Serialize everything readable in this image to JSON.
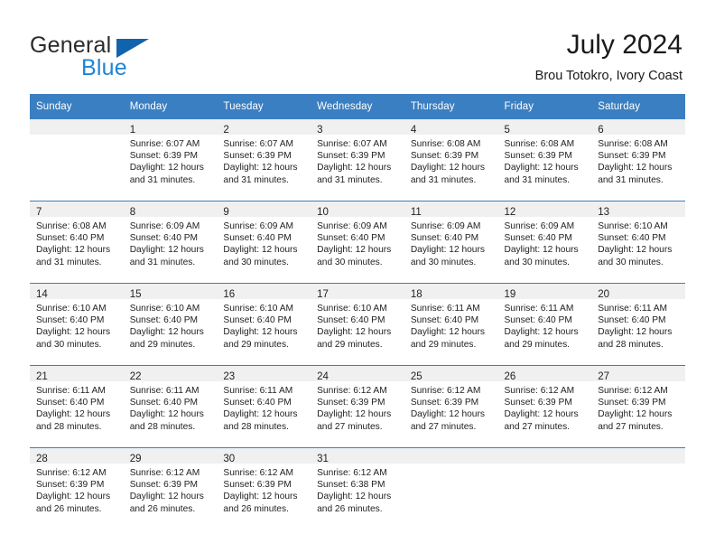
{
  "brand": {
    "name_part1": "General",
    "name_part2": "Blue",
    "color_primary": "#1f85d4",
    "color_triangle": "#1263ad"
  },
  "header": {
    "title": "July 2024",
    "subtitle": "Brou Totokro, Ivory Coast"
  },
  "theme": {
    "header_row_bg": "#3a7fc1",
    "daynum_band_bg": "#f0f0f0",
    "separator": "#3a7fc1"
  },
  "weekday_headers": [
    "Sunday",
    "Monday",
    "Tuesday",
    "Wednesday",
    "Thursday",
    "Friday",
    "Saturday"
  ],
  "weeks": [
    [
      {
        "day": "",
        "sunrise": "",
        "sunset": "",
        "daylight1": "",
        "daylight2": ""
      },
      {
        "day": "1",
        "sunrise": "Sunrise: 6:07 AM",
        "sunset": "Sunset: 6:39 PM",
        "daylight1": "Daylight: 12 hours",
        "daylight2": "and 31 minutes."
      },
      {
        "day": "2",
        "sunrise": "Sunrise: 6:07 AM",
        "sunset": "Sunset: 6:39 PM",
        "daylight1": "Daylight: 12 hours",
        "daylight2": "and 31 minutes."
      },
      {
        "day": "3",
        "sunrise": "Sunrise: 6:07 AM",
        "sunset": "Sunset: 6:39 PM",
        "daylight1": "Daylight: 12 hours",
        "daylight2": "and 31 minutes."
      },
      {
        "day": "4",
        "sunrise": "Sunrise: 6:08 AM",
        "sunset": "Sunset: 6:39 PM",
        "daylight1": "Daylight: 12 hours",
        "daylight2": "and 31 minutes."
      },
      {
        "day": "5",
        "sunrise": "Sunrise: 6:08 AM",
        "sunset": "Sunset: 6:39 PM",
        "daylight1": "Daylight: 12 hours",
        "daylight2": "and 31 minutes."
      },
      {
        "day": "6",
        "sunrise": "Sunrise: 6:08 AM",
        "sunset": "Sunset: 6:39 PM",
        "daylight1": "Daylight: 12 hours",
        "daylight2": "and 31 minutes."
      }
    ],
    [
      {
        "day": "7",
        "sunrise": "Sunrise: 6:08 AM",
        "sunset": "Sunset: 6:40 PM",
        "daylight1": "Daylight: 12 hours",
        "daylight2": "and 31 minutes."
      },
      {
        "day": "8",
        "sunrise": "Sunrise: 6:09 AM",
        "sunset": "Sunset: 6:40 PM",
        "daylight1": "Daylight: 12 hours",
        "daylight2": "and 31 minutes."
      },
      {
        "day": "9",
        "sunrise": "Sunrise: 6:09 AM",
        "sunset": "Sunset: 6:40 PM",
        "daylight1": "Daylight: 12 hours",
        "daylight2": "and 30 minutes."
      },
      {
        "day": "10",
        "sunrise": "Sunrise: 6:09 AM",
        "sunset": "Sunset: 6:40 PM",
        "daylight1": "Daylight: 12 hours",
        "daylight2": "and 30 minutes."
      },
      {
        "day": "11",
        "sunrise": "Sunrise: 6:09 AM",
        "sunset": "Sunset: 6:40 PM",
        "daylight1": "Daylight: 12 hours",
        "daylight2": "and 30 minutes."
      },
      {
        "day": "12",
        "sunrise": "Sunrise: 6:09 AM",
        "sunset": "Sunset: 6:40 PM",
        "daylight1": "Daylight: 12 hours",
        "daylight2": "and 30 minutes."
      },
      {
        "day": "13",
        "sunrise": "Sunrise: 6:10 AM",
        "sunset": "Sunset: 6:40 PM",
        "daylight1": "Daylight: 12 hours",
        "daylight2": "and 30 minutes."
      }
    ],
    [
      {
        "day": "14",
        "sunrise": "Sunrise: 6:10 AM",
        "sunset": "Sunset: 6:40 PM",
        "daylight1": "Daylight: 12 hours",
        "daylight2": "and 30 minutes."
      },
      {
        "day": "15",
        "sunrise": "Sunrise: 6:10 AM",
        "sunset": "Sunset: 6:40 PM",
        "daylight1": "Daylight: 12 hours",
        "daylight2": "and 29 minutes."
      },
      {
        "day": "16",
        "sunrise": "Sunrise: 6:10 AM",
        "sunset": "Sunset: 6:40 PM",
        "daylight1": "Daylight: 12 hours",
        "daylight2": "and 29 minutes."
      },
      {
        "day": "17",
        "sunrise": "Sunrise: 6:10 AM",
        "sunset": "Sunset: 6:40 PM",
        "daylight1": "Daylight: 12 hours",
        "daylight2": "and 29 minutes."
      },
      {
        "day": "18",
        "sunrise": "Sunrise: 6:11 AM",
        "sunset": "Sunset: 6:40 PM",
        "daylight1": "Daylight: 12 hours",
        "daylight2": "and 29 minutes."
      },
      {
        "day": "19",
        "sunrise": "Sunrise: 6:11 AM",
        "sunset": "Sunset: 6:40 PM",
        "daylight1": "Daylight: 12 hours",
        "daylight2": "and 29 minutes."
      },
      {
        "day": "20",
        "sunrise": "Sunrise: 6:11 AM",
        "sunset": "Sunset: 6:40 PM",
        "daylight1": "Daylight: 12 hours",
        "daylight2": "and 28 minutes."
      }
    ],
    [
      {
        "day": "21",
        "sunrise": "Sunrise: 6:11 AM",
        "sunset": "Sunset: 6:40 PM",
        "daylight1": "Daylight: 12 hours",
        "daylight2": "and 28 minutes."
      },
      {
        "day": "22",
        "sunrise": "Sunrise: 6:11 AM",
        "sunset": "Sunset: 6:40 PM",
        "daylight1": "Daylight: 12 hours",
        "daylight2": "and 28 minutes."
      },
      {
        "day": "23",
        "sunrise": "Sunrise: 6:11 AM",
        "sunset": "Sunset: 6:40 PM",
        "daylight1": "Daylight: 12 hours",
        "daylight2": "and 28 minutes."
      },
      {
        "day": "24",
        "sunrise": "Sunrise: 6:12 AM",
        "sunset": "Sunset: 6:39 PM",
        "daylight1": "Daylight: 12 hours",
        "daylight2": "and 27 minutes."
      },
      {
        "day": "25",
        "sunrise": "Sunrise: 6:12 AM",
        "sunset": "Sunset: 6:39 PM",
        "daylight1": "Daylight: 12 hours",
        "daylight2": "and 27 minutes."
      },
      {
        "day": "26",
        "sunrise": "Sunrise: 6:12 AM",
        "sunset": "Sunset: 6:39 PM",
        "daylight1": "Daylight: 12 hours",
        "daylight2": "and 27 minutes."
      },
      {
        "day": "27",
        "sunrise": "Sunrise: 6:12 AM",
        "sunset": "Sunset: 6:39 PM",
        "daylight1": "Daylight: 12 hours",
        "daylight2": "and 27 minutes."
      }
    ],
    [
      {
        "day": "28",
        "sunrise": "Sunrise: 6:12 AM",
        "sunset": "Sunset: 6:39 PM",
        "daylight1": "Daylight: 12 hours",
        "daylight2": "and 26 minutes."
      },
      {
        "day": "29",
        "sunrise": "Sunrise: 6:12 AM",
        "sunset": "Sunset: 6:39 PM",
        "daylight1": "Daylight: 12 hours",
        "daylight2": "and 26 minutes."
      },
      {
        "day": "30",
        "sunrise": "Sunrise: 6:12 AM",
        "sunset": "Sunset: 6:39 PM",
        "daylight1": "Daylight: 12 hours",
        "daylight2": "and 26 minutes."
      },
      {
        "day": "31",
        "sunrise": "Sunrise: 6:12 AM",
        "sunset": "Sunset: 6:38 PM",
        "daylight1": "Daylight: 12 hours",
        "daylight2": "and 26 minutes."
      },
      {
        "day": "",
        "sunrise": "",
        "sunset": "",
        "daylight1": "",
        "daylight2": ""
      },
      {
        "day": "",
        "sunrise": "",
        "sunset": "",
        "daylight1": "",
        "daylight2": ""
      },
      {
        "day": "",
        "sunrise": "",
        "sunset": "",
        "daylight1": "",
        "daylight2": ""
      }
    ]
  ]
}
